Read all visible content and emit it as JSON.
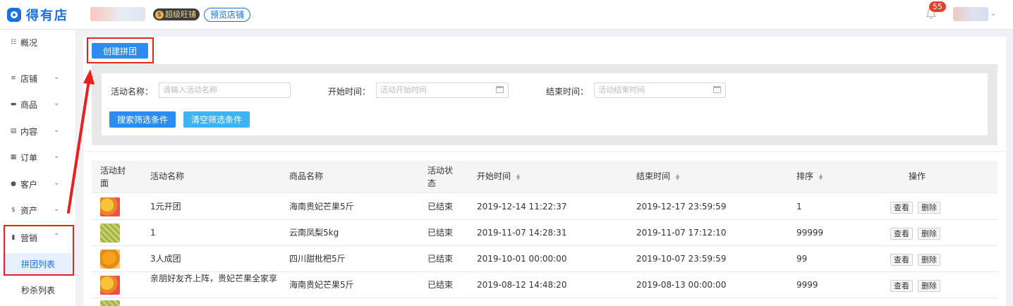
{
  "header": {
    "logo_text": "得有店",
    "level_badge": "超级旺铺",
    "level_coin": "$",
    "preview_label": "预览店铺",
    "notification_count": "55"
  },
  "sidebar": {
    "items": [
      {
        "label": "概况",
        "icon": "grid-icon"
      },
      {
        "label": "店铺",
        "icon": "store-icon"
      },
      {
        "label": "商品",
        "icon": "goods-icon"
      },
      {
        "label": "内容",
        "icon": "content-icon"
      },
      {
        "label": "订单",
        "icon": "order-icon"
      },
      {
        "label": "客户",
        "icon": "customer-icon"
      },
      {
        "label": "资产",
        "icon": "asset-icon"
      },
      {
        "label": "营销",
        "icon": "bar-chart-icon"
      }
    ],
    "sub_items": [
      {
        "label": "拼团列表",
        "active": true
      },
      {
        "label": "秒杀列表",
        "active": false
      }
    ]
  },
  "toolbar": {
    "create_label": "创建拼团"
  },
  "filters": {
    "name_label": "活动名称：",
    "name_placeholder": "请输入活动名称",
    "start_label": "开始时间：",
    "start_placeholder": "活动开始时间",
    "end_label": "结束时间：",
    "end_placeholder": "活动结束时间",
    "search_label": "搜索筛选条件",
    "clear_label": "清空筛选条件"
  },
  "table": {
    "headers": {
      "cover_a": "活动封",
      "cover_b": "面",
      "name": "活动名称",
      "product": "商品名称",
      "status_a": "活动状",
      "status_b": "态",
      "start": "开始时间",
      "end": "结束时间",
      "sort": "排序",
      "ops": "操作"
    },
    "view_label": "查看",
    "delete_label": "删除",
    "rows": [
      {
        "name": "1元开团",
        "product": "海南贵妃芒果5斤",
        "status": "已结束",
        "start": "2019-12-14 11:22:37",
        "end": "2019-12-17 23:59:59",
        "sort": "1"
      },
      {
        "name": "1",
        "product": "云南凤梨5kg",
        "status": "已结束",
        "start": "2019-11-07 14:28:31",
        "end": "2019-11-07 17:12:10",
        "sort": "99999"
      },
      {
        "name": "3人成团",
        "product": "四川甜枇杷5斤",
        "status": "已结束",
        "start": "2019-10-01 00:00:00",
        "end": "2019-10-07 23:59:59",
        "sort": "99"
      },
      {
        "name": "亲朋好友齐上阵，贵妃芒果全家享",
        "product": "海南贵妃芒果5斤",
        "status": "已结束",
        "start": "2019-08-12 14:48:20",
        "end": "2019-08-13 00:00:00",
        "sort": "9999"
      }
    ]
  },
  "colors": {
    "primary": "#2d8cf0",
    "clear_button": "#3fb3f0",
    "brand": "#1b6fe0",
    "highlight": "#e8211c",
    "badge": "#e0422b"
  }
}
